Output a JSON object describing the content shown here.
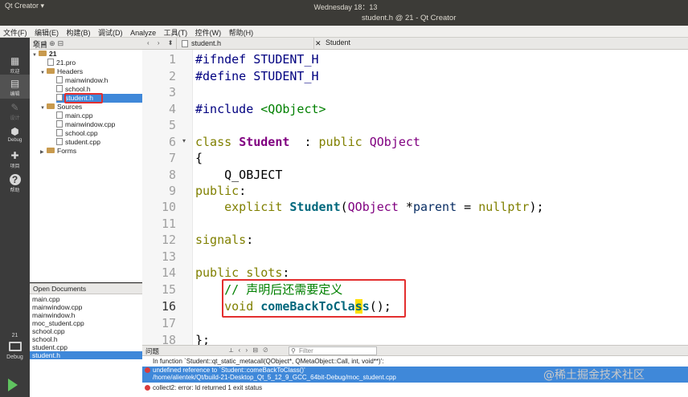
{
  "system": {
    "app_menu": "Qt Creator ▾",
    "clock": "Wednesday 18：13"
  },
  "window": {
    "title": "student.h @ 21 - Qt Creator"
  },
  "menu": [
    "文件(F)",
    "编辑(E)",
    "构建(B)",
    "调试(D)",
    "Analyze",
    "工具(T)",
    "控件(W)",
    "帮助(H)"
  ],
  "modes": [
    {
      "label": "欢迎",
      "icon": "grid-icon"
    },
    {
      "label": "编辑",
      "icon": "edit-icon"
    },
    {
      "label": "设计",
      "icon": "pencil-icon"
    },
    {
      "label": "Debug",
      "icon": "bug-icon"
    },
    {
      "label": "项目",
      "icon": "wrench-icon"
    },
    {
      "label": "帮助",
      "icon": "help-icon"
    }
  ],
  "kit": {
    "number": "21",
    "label": "Debug"
  },
  "project_panel": {
    "title": "项目",
    "tree": [
      {
        "label": "21"
      },
      {
        "label": "21.pro"
      },
      {
        "label": "Headers"
      },
      {
        "label": "mainwindow.h"
      },
      {
        "label": "school.h"
      },
      {
        "label": "student.h"
      },
      {
        "label": "Sources"
      },
      {
        "label": "main.cpp"
      },
      {
        "label": "mainwindow.cpp"
      },
      {
        "label": "school.cpp"
      },
      {
        "label": "student.cpp"
      },
      {
        "label": "Forms"
      }
    ]
  },
  "open_documents": {
    "title": "Open Documents",
    "items": [
      "main.cpp",
      "mainwindow.cpp",
      "mainwindow.h",
      "moc_student.cpp",
      "school.cpp",
      "school.h",
      "student.cpp",
      "student.h"
    ]
  },
  "editor": {
    "file_tab": "student.h",
    "class_crumb": "Student",
    "current_line": 16,
    "line_numbers": [
      "1",
      "2",
      "3",
      "4",
      "5",
      "6",
      "7",
      "8",
      "9",
      "10",
      "11",
      "12",
      "13",
      "14",
      "15",
      "16",
      "17",
      "18"
    ]
  },
  "issues": {
    "title": "问题",
    "filter_placeholder": "Filter",
    "rows": [
      "In function `Student::qt_static_metacall(QObject*, QMetaObject::Call, int, void**)':",
      "undefined reference to `Student::comeBackToClass()'",
      "/home/alientek/Qt/build-21-Desktop_Qt_5_12_9_GCC_64bit-Debug/moc_student.cpp",
      "collect2: error: ld returned 1 exit status"
    ]
  },
  "watermark": "@稀土掘金技术社区"
}
